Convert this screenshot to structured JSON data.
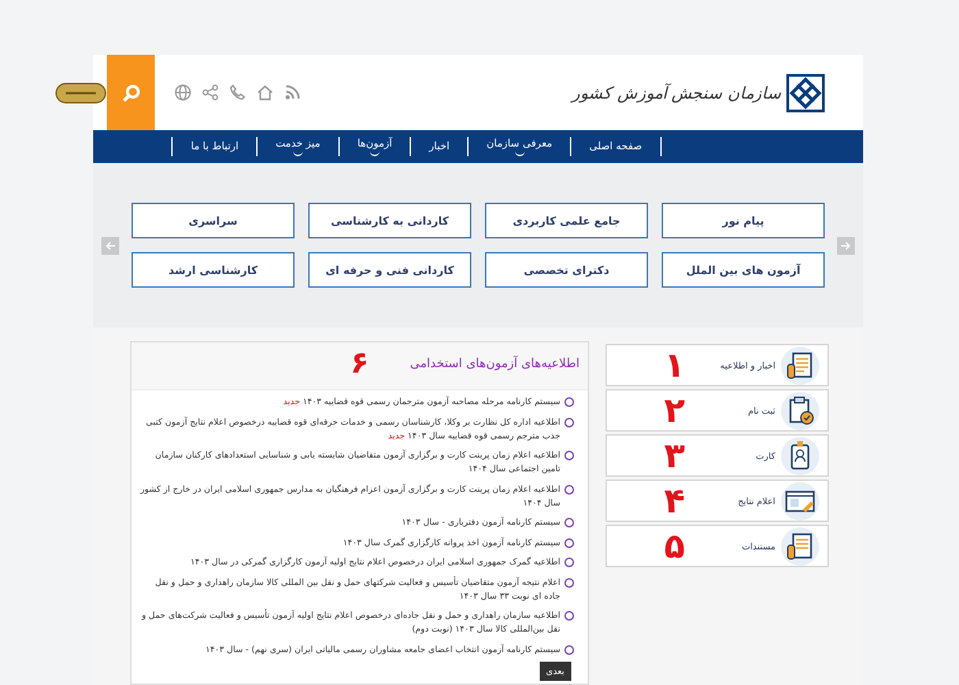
{
  "header": {
    "logo_text": "سازمان سنجش آموزش کشور"
  },
  "nav": [
    {
      "label": "صفحه اصلی",
      "has_menu": false
    },
    {
      "label": "معرفی سازمان",
      "has_menu": true
    },
    {
      "label": "اخبار",
      "has_menu": false
    },
    {
      "label": "آزمون‌ها",
      "has_menu": true
    },
    {
      "label": "میز خدمت",
      "has_menu": true
    },
    {
      "label": "ارتباط با ما",
      "has_menu": false
    }
  ],
  "exam_tiles": [
    "پیام نور",
    "جامع علمی کاربردی",
    "کاردانی به کارشناسی",
    "سراسری",
    "آزمون های بین الملل",
    "دکترای تخصصی",
    "کاردانی فنی و حرفه ای",
    "کارشناسی ارشد"
  ],
  "news": {
    "title": "اطلاعیه‌های آزمون‌های استخدامی",
    "marker": "۶",
    "items": [
      {
        "text": "سیستم کارنامه مرحله مصاحبه آزمون مترجمان رسمی قوه قضاییه ۱۴۰۳",
        "new_label": "جدید"
      },
      {
        "text": "اطلاعیه اداره کل نظارت بر وکلا، کارشناسان رسمی و خدمات حرفه‌ای قوه قضاییه درخصوص اعلام نتایج آزمون کتبی جذب مترجم رسمی قوه قضاییه سال ۱۴۰۳",
        "new_label": "جدید"
      },
      {
        "text": "اطلاعیه اعلام زمان پرینت کارت و برگزاری آزمون متقاضیان شایسته یابی و شناسایی استعدادهای کارکنان سازمان تامین اجتماعی سال ۱۴۰۴"
      },
      {
        "text": "اطلاعیه اعلام زمان پرینت کارت و برگزاری آزمون اعزام فرهنگیان به مدارس جمهوری اسلامی ایران در خارج از کشور سال ۱۴۰۴"
      },
      {
        "text": "سیستم کارنامه آزمون دفتریاری - سال ۱۴۰۳"
      },
      {
        "text": "سیستم کارنامه آزمون اخذ پروانه کارگزاری گمرک سال ۱۴۰۳"
      },
      {
        "text": "اطلاعیه گمرک جمهوری اسلامی ایران درخصوص اعلام نتایج اولیه آزمون کارگزاری گمرکی در سال ۱۴۰۳"
      },
      {
        "text": "اعلام نتیجه آزمون متقاضیان تأسیس و فعالیت شرکتهای حمل و نقل بین المللی کالا سازمان راهداری و حمل و نقل جاده ای نوبت ۳۳ سال ۱۴۰۳"
      },
      {
        "text": "اطلاعیه سازمان راهداری و حمل و نقل جاده‌ای درخصوص اعلام نتایج اولیه آزمون تأسیس و فعالیت شرکت‌های حمل و نقل بین‌المللی کالا سال ۱۴۰۳ (نوبت دوم)"
      },
      {
        "text": "سیستم کارنامه آزمون انتخاب اعضای جامعه مشاوران رسمی مالیاتی ایران (سری نهم) - سال ۱۴۰۳"
      }
    ],
    "next_button": "بعدی"
  },
  "side_menu": [
    {
      "label": "اخبار و اطلاعیه",
      "kind": "news",
      "marker": "۱"
    },
    {
      "label": "ثبت نام",
      "kind": "register",
      "marker": "۲"
    },
    {
      "label": "کارت",
      "kind": "card",
      "marker": "۳"
    },
    {
      "label": "اعلام نتایج",
      "kind": "results",
      "marker": "۴"
    },
    {
      "label": "مستندات",
      "kind": "documents",
      "marker": "۵"
    }
  ]
}
